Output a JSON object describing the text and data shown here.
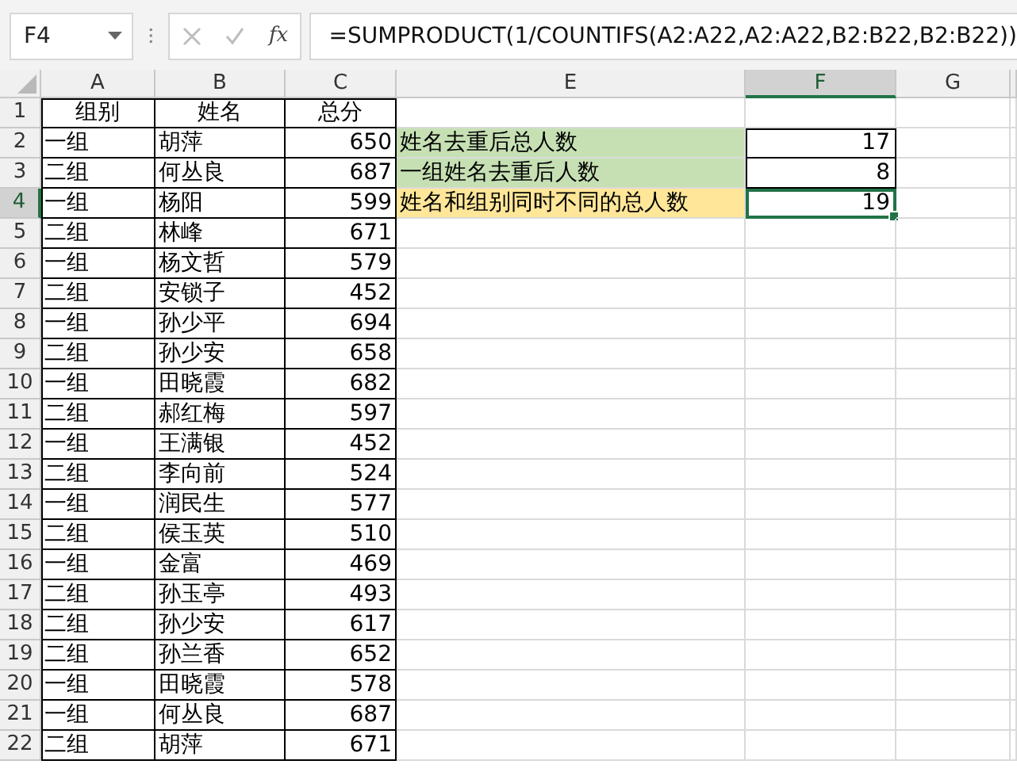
{
  "name_box": "F4",
  "fx_label": "fx",
  "formula": "=SUMPRODUCT(1/COUNTIFS(A2:A22,A2:A22,B2:B22,B2:B22))",
  "columns": [
    {
      "label": "A",
      "selected": false
    },
    {
      "label": "B",
      "selected": false
    },
    {
      "label": "C",
      "selected": false
    },
    {
      "label": "E",
      "selected": false
    },
    {
      "label": "F",
      "selected": true
    },
    {
      "label": "G",
      "selected": false
    }
  ],
  "rows": [
    {
      "number": "1",
      "selected": false,
      "cells": [
        "组别",
        "姓名",
        "总分"
      ]
    },
    {
      "number": "2",
      "selected": false,
      "cells": [
        "一组",
        "胡萍",
        "650"
      ]
    },
    {
      "number": "3",
      "selected": false,
      "cells": [
        "二组",
        "何丛良",
        "687"
      ]
    },
    {
      "number": "4",
      "selected": true,
      "cells": [
        "一组",
        "杨阳",
        "599"
      ]
    },
    {
      "number": "5",
      "selected": false,
      "cells": [
        "二组",
        "林峰",
        "671"
      ]
    },
    {
      "number": "6",
      "selected": false,
      "cells": [
        "一组",
        "杨文哲",
        "579"
      ]
    },
    {
      "number": "7",
      "selected": false,
      "cells": [
        "二组",
        "安锁子",
        "452"
      ]
    },
    {
      "number": "8",
      "selected": false,
      "cells": [
        "一组",
        "孙少平",
        "694"
      ]
    },
    {
      "number": "9",
      "selected": false,
      "cells": [
        "二组",
        "孙少安",
        "658"
      ]
    },
    {
      "number": "10",
      "selected": false,
      "cells": [
        "一组",
        "田晓霞",
        "682"
      ]
    },
    {
      "number": "11",
      "selected": false,
      "cells": [
        "二组",
        "郝红梅",
        "597"
      ]
    },
    {
      "number": "12",
      "selected": false,
      "cells": [
        "一组",
        "王满银",
        "452"
      ]
    },
    {
      "number": "13",
      "selected": false,
      "cells": [
        "二组",
        "李向前",
        "524"
      ]
    },
    {
      "number": "14",
      "selected": false,
      "cells": [
        "一组",
        "润民生",
        "577"
      ]
    },
    {
      "number": "15",
      "selected": false,
      "cells": [
        "二组",
        "侯玉英",
        "510"
      ]
    },
    {
      "number": "16",
      "selected": false,
      "cells": [
        "一组",
        "金富",
        "469"
      ]
    },
    {
      "number": "17",
      "selected": false,
      "cells": [
        "二组",
        "孙玉亭",
        "493"
      ]
    },
    {
      "number": "18",
      "selected": false,
      "cells": [
        "二组",
        "孙少安",
        "617"
      ]
    },
    {
      "number": "19",
      "selected": false,
      "cells": [
        "二组",
        "孙兰香",
        "652"
      ]
    },
    {
      "number": "20",
      "selected": false,
      "cells": [
        "一组",
        "田晓霞",
        "578"
      ]
    },
    {
      "number": "21",
      "selected": false,
      "cells": [
        "一组",
        "何丛良",
        "687"
      ]
    },
    {
      "number": "22",
      "selected": false,
      "cells": [
        "二组",
        "胡萍",
        "671"
      ]
    }
  ],
  "summary": [
    {
      "label": "姓名去重后总人数",
      "value": "17",
      "color": "#c6e0b4",
      "selected": false
    },
    {
      "label": "一组姓名去重后人数",
      "value": "8",
      "color": "#c6e0b4",
      "selected": false
    },
    {
      "label": "姓名和组别同时不同的总人数",
      "value": "19",
      "color": "#ffe699",
      "selected": true
    }
  ]
}
